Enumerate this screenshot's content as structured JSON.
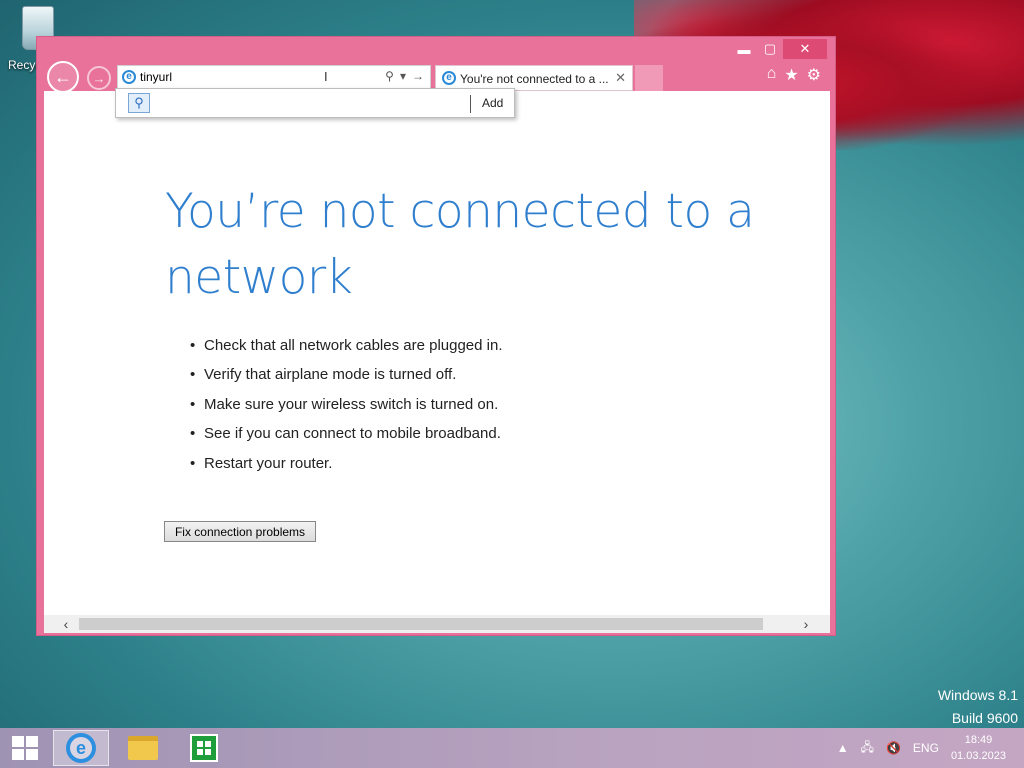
{
  "desktop": {
    "recycle_bin_label": "Recyc",
    "watermark_line1": "Windows 8.1",
    "watermark_line2": "Build 9600"
  },
  "browser": {
    "window_controls": {
      "minimize": "▬",
      "maximize": "▢",
      "close": "✕"
    },
    "address_value": "tinyurl",
    "address_placeholder": "",
    "tab_title": "You're not connected to a ...",
    "tab_close": "✕",
    "suggest_add": "Add",
    "toolbar_icons": [
      "home-icon",
      "favorites-icon",
      "settings-icon"
    ]
  },
  "page": {
    "headline_line1": "You’re not connected to a",
    "headline_line2": "network",
    "tips": [
      "Check that all network cables are plugged in.",
      "Verify that airplane mode is turned off.",
      "Make sure your wireless switch is turned on.",
      "See if you can connect to mobile broadband.",
      "Restart your router."
    ],
    "fix_button": "Fix connection problems"
  },
  "taskbar": {
    "language": "ENG",
    "time": "18:49",
    "date": "01.03.2023"
  },
  "colors": {
    "window_frame": "#e8729a",
    "headline": "#2f7fce",
    "taskbar": "#b9a3c0"
  }
}
